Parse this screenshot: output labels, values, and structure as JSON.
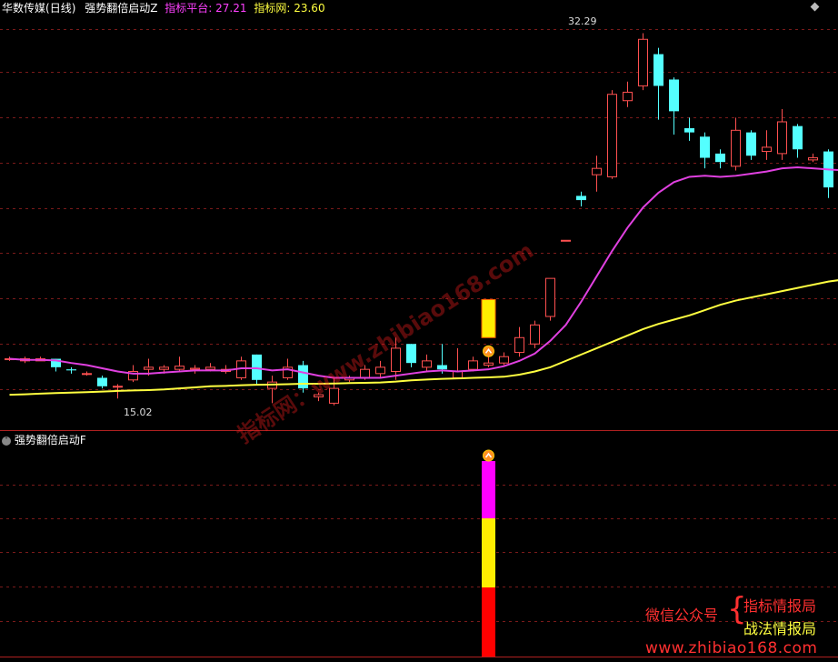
{
  "header": {
    "stock_name": "华数传媒",
    "period": "(日线)",
    "indicator_name": "强势翻倍启动Z",
    "platform_label": "指标平台:",
    "platform_value": "27.21",
    "net_label": "指标网:",
    "net_value": "23.60"
  },
  "sub_panel": {
    "title": "强势翻倍启动F"
  },
  "annotations": {
    "high": "32.29",
    "low": "15.02"
  },
  "watermark": "指标网：www.zhibiao168.com",
  "promo": {
    "wechat": "微信公众号",
    "brace": "{",
    "line1": "指标情报局",
    "line2": "战法情报局",
    "url": "www.zhibiao168.com"
  },
  "colors": {
    "background": "#000000",
    "up": "#ff5050",
    "down": "#54ffff",
    "ma_short": "#e040e0",
    "ma_long": "#ffff40",
    "signal_yellow": "#ffee00",
    "signal_magenta": "#ff00ff",
    "signal_red": "#ff0000",
    "grid": "#7a1a1a"
  },
  "chart_data": {
    "type": "candlestick",
    "y_range": [
      14.0,
      33.0
    ],
    "candles": [
      [
        16.9,
        16.9,
        17.0,
        16.8
      ],
      [
        16.8,
        16.9,
        17.0,
        16.7
      ],
      [
        16.8,
        16.9,
        17.0,
        16.8
      ],
      [
        16.9,
        16.5,
        16.9,
        16.3
      ],
      [
        16.4,
        16.35,
        16.5,
        16.2
      ],
      [
        16.2,
        16.2,
        16.3,
        16.1
      ],
      [
        16.0,
        15.6,
        16.1,
        15.5
      ],
      [
        15.6,
        15.6,
        15.7,
        15.02
      ],
      [
        15.9,
        16.3,
        16.6,
        15.8
      ],
      [
        16.4,
        16.5,
        16.9,
        16.1
      ],
      [
        16.4,
        16.5,
        16.6,
        16.2
      ],
      [
        16.4,
        16.55,
        17.0,
        16.3
      ],
      [
        16.4,
        16.45,
        16.6,
        16.2
      ],
      [
        16.4,
        16.5,
        16.7,
        16.3
      ],
      [
        16.3,
        16.4,
        16.6,
        16.2
      ],
      [
        16.0,
        16.8,
        17.0,
        15.9
      ],
      [
        17.1,
        15.9,
        17.1,
        15.7
      ],
      [
        15.5,
        15.8,
        16.1,
        14.8
      ],
      [
        16.0,
        16.5,
        16.9,
        15.9
      ],
      [
        16.6,
        15.5,
        16.8,
        15.3
      ],
      [
        15.1,
        15.2,
        15.3,
        14.9
      ],
      [
        14.8,
        15.5,
        16.0,
        14.7
      ],
      [
        15.9,
        16.0,
        16.1,
        15.8
      ],
      [
        16.0,
        16.4,
        16.6,
        15.9
      ],
      [
        16.2,
        16.5,
        16.8,
        16.0
      ],
      [
        16.3,
        17.4,
        17.9,
        15.9
      ],
      [
        17.6,
        16.7,
        17.6,
        16.5
      ],
      [
        16.5,
        16.8,
        17.1,
        16.3
      ],
      [
        16.6,
        16.4,
        17.6,
        16.2
      ],
      [
        16.0,
        16.3,
        17.4,
        16.0
      ],
      [
        16.4,
        16.8,
        17.0,
        16.3
      ],
      [
        16.6,
        16.7,
        17.0,
        16.5
      ],
      [
        16.7,
        17.0,
        17.2,
        16.6
      ],
      [
        17.2,
        17.9,
        18.4,
        17.0
      ],
      [
        17.6,
        18.5,
        18.7,
        17.4
      ],
      [
        18.9,
        20.7,
        20.7,
        18.7
      ],
      [
        22.5,
        22.5,
        22.5,
        22.5
      ],
      [
        24.6,
        24.4,
        24.8,
        24.1
      ],
      [
        25.6,
        25.9,
        26.5,
        24.8
      ],
      [
        25.5,
        29.4,
        29.6,
        25.4
      ],
      [
        29.1,
        29.5,
        30.0,
        28.8
      ],
      [
        29.8,
        32.0,
        32.29,
        29.6
      ],
      [
        31.3,
        29.8,
        31.6,
        28.2
      ],
      [
        30.1,
        28.6,
        30.2,
        27.5
      ],
      [
        27.8,
        27.6,
        28.3,
        27.2
      ],
      [
        27.4,
        26.4,
        27.6,
        25.9
      ],
      [
        26.6,
        26.2,
        26.8,
        25.9
      ],
      [
        26.0,
        27.7,
        28.3,
        25.8
      ],
      [
        27.6,
        26.5,
        27.7,
        26.3
      ],
      [
        26.7,
        26.9,
        27.7,
        26.3
      ],
      [
        26.6,
        28.1,
        28.7,
        26.3
      ],
      [
        27.9,
        26.8,
        28.0,
        26.4
      ],
      [
        26.3,
        26.4,
        26.6,
        26.2
      ],
      [
        26.7,
        25.0,
        26.8,
        24.5
      ],
      [
        25.1,
        25.0,
        25.7,
        24.4
      ],
      [
        25.1,
        26.4,
        27.5,
        24.8
      ],
      [
        26.4,
        26.6,
        27.4,
        26.3
      ],
      [
        26.3,
        27.7,
        28.8,
        26.1
      ],
      [
        27.8,
        26.8,
        27.9,
        26.6
      ],
      [
        27.2,
        26.2,
        28.6,
        25.8
      ]
    ],
    "ma_short": [
      16.9,
      16.85,
      16.85,
      16.82,
      16.7,
      16.6,
      16.45,
      16.3,
      16.2,
      16.2,
      16.25,
      16.3,
      16.35,
      16.35,
      16.35,
      16.45,
      16.45,
      16.35,
      16.4,
      16.25,
      16.1,
      16.0,
      16.0,
      16.0,
      16.0,
      16.1,
      16.2,
      16.3,
      16.35,
      16.3,
      16.35,
      16.4,
      16.55,
      16.8,
      17.15,
      17.75,
      18.5,
      19.6,
      20.8,
      22.0,
      23.1,
      24.05,
      24.75,
      25.25,
      25.5,
      25.55,
      25.5,
      25.55,
      25.65,
      25.75,
      25.9,
      25.95,
      25.9,
      25.85,
      25.8,
      25.9,
      25.95,
      26.1,
      26.2,
      26.3
    ],
    "ma_long": [
      15.2,
      15.22,
      15.25,
      15.28,
      15.3,
      15.32,
      15.35,
      15.38,
      15.4,
      15.42,
      15.45,
      15.5,
      15.55,
      15.6,
      15.62,
      15.65,
      15.67,
      15.68,
      15.7,
      15.72,
      15.72,
      15.73,
      15.75,
      15.76,
      15.78,
      15.82,
      15.88,
      15.92,
      15.95,
      15.97,
      16.0,
      16.02,
      16.05,
      16.15,
      16.3,
      16.5,
      16.8,
      17.1,
      17.4,
      17.7,
      18.0,
      18.3,
      18.55,
      18.75,
      18.95,
      19.2,
      19.45,
      19.65,
      19.8,
      19.95,
      20.1,
      20.25,
      20.4,
      20.55,
      20.65,
      20.75,
      20.85,
      20.98,
      21.12,
      21.25
    ],
    "signal_index": 31,
    "signal_bar": [
      17.9,
      19.7
    ]
  }
}
